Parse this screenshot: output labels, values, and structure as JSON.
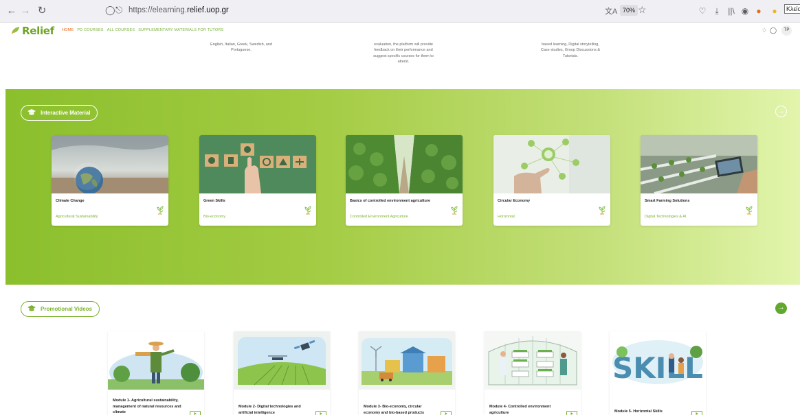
{
  "browser": {
    "url_prefix": "https://elearning.",
    "url_domain": "relief.uop.gr",
    "zoom": "70%",
    "close_tooltip": "Κλείσι"
  },
  "site": {
    "logo_text": "Relief",
    "nav": [
      "HOME",
      "PD COURSES",
      "ALL COURSES",
      "SUPPLEMENTARY MATERIALS FOR TUTORS"
    ],
    "avatar_initials": "TP"
  },
  "features": [
    "English, Italian, Greek, Swedish, and\nPortuguese.",
    "evaluation, the platform will provide\nfeedback on their performance and\nsuggest specific courses for them to\nattend.",
    "based learning, Digital storytelling,\nCase studies, Group Discussions &\nTutorials."
  ],
  "interactive": {
    "heading": "Interactive Material",
    "cards": [
      {
        "title": "Climate Change",
        "category": "Agricultural Sustainability"
      },
      {
        "title": "Green Skills",
        "category": "Bio-economy"
      },
      {
        "title": "Basics of controlled environment agriculture",
        "category": "Controlled Environment Agriculture"
      },
      {
        "title": "Circular Economy",
        "category": "Horizontal"
      },
      {
        "title": "Smart Farming Solutions",
        "category": "Digital Technologies & AI"
      }
    ]
  },
  "promotional": {
    "heading": "Promotional Videos",
    "videos": [
      {
        "title": "Module 1- Agricultural sustainability, management of natural resources and climate"
      },
      {
        "title": "Module 2- Digital technologies and artificial intelligence"
      },
      {
        "title": "Module 3- Bio-economy, circular economy and bio-based products"
      },
      {
        "title": "Module 4- Controlled environment agriculture"
      },
      {
        "title": "Module 5- Horizontal Skills"
      }
    ]
  },
  "colors": {
    "brand_green": "#7bb32e",
    "nav_active": "#e6691e",
    "section_start": "#8bbf2c",
    "section_end": "#e2f5ac"
  },
  "icons": [
    "back-arrow-icon",
    "forward-arrow-icon",
    "reload-icon",
    "shield-icon",
    "lock-icon",
    "translate-icon",
    "star-icon",
    "pocket-icon",
    "download-icon",
    "library-icon",
    "account-icon",
    "extension-icon",
    "graduation-cap-icon",
    "plant-icon",
    "arrow-right-circle-icon",
    "bell-icon",
    "chat-icon"
  ]
}
